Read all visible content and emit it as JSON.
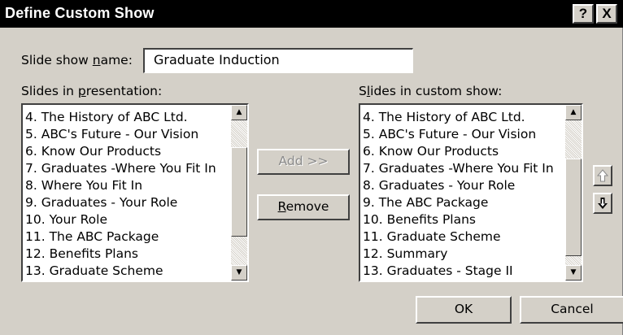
{
  "window": {
    "title": "Define Custom Show",
    "help_label": "?",
    "close_label": "X"
  },
  "name_field": {
    "label_pre": "Slide show ",
    "label_key": "n",
    "label_post": "ame:",
    "value": "Graduate Induction"
  },
  "presentation_list": {
    "label_pre": "Slides in ",
    "label_key": "p",
    "label_post": "resentation:",
    "items": [
      "4. The History of ABC Ltd.",
      "5. ABC's Future - Our Vision",
      "6. Know Our Products",
      "7. Graduates -Where You Fit In",
      "8. Where You Fit In",
      "9. Graduates - Your Role",
      "10. Your Role",
      "11. The ABC Package",
      "12. Benefits Plans",
      "13. Graduate Scheme"
    ]
  },
  "custom_list": {
    "label_pre": "S",
    "label_key": "l",
    "label_post": "ides in custom show:",
    "items": [
      "4. The History of ABC Ltd.",
      "5. ABC's Future - Our Vision",
      "6. Know Our Products",
      "7. Graduates -Where You Fit In",
      "8. Graduates - Your Role",
      "9. The ABC Package",
      "10. Benefits Plans",
      "11. Graduate Scheme",
      "12. Summary",
      "13. Graduates - Stage II"
    ]
  },
  "buttons": {
    "add": "Add >>",
    "remove_key": "R",
    "remove_post": "emove",
    "ok": "OK",
    "cancel": "Cancel"
  },
  "icons": {
    "move_up": "up-arrow-icon",
    "move_down": "down-arrow-icon",
    "scroll_up": "scroll-up-icon",
    "scroll_down": "scroll-down-icon"
  },
  "colors": {
    "titlebar": "#000000",
    "dialog_face": "#d4d0c8",
    "disabled_text": "#8a8a8a"
  }
}
